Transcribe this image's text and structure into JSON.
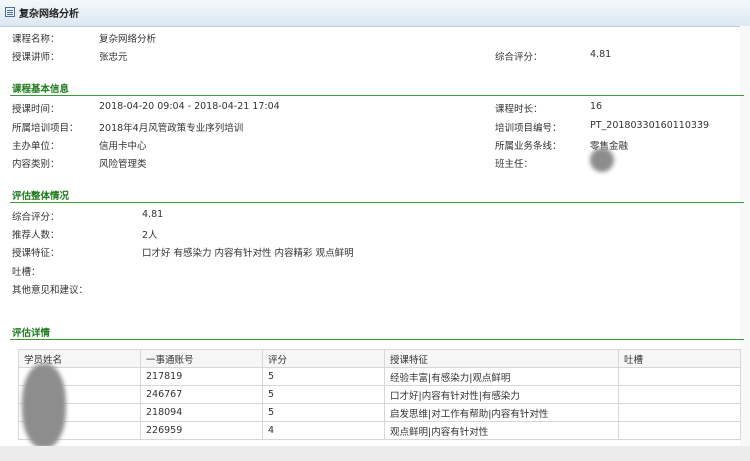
{
  "window": {
    "title": "复杂网络分析"
  },
  "header": {
    "course_name_label": "课程名称：",
    "course_name": "复杂网络分析",
    "instructor_label": "授课讲师：",
    "instructor": "张忠元",
    "score_label": "综合评分：",
    "score": "4.81"
  },
  "basic": {
    "title": "课程基本信息",
    "time_label": "授课时间：",
    "time": "2018-04-20 09:04 - 2018-04-21 17:04",
    "duration_label": "课程时长：",
    "duration": "16",
    "project_label": "所属培训项目：",
    "project": "2018年4月风管政策专业序列培训",
    "project_no_label": "培训项目编号：",
    "project_no": "PT_20180330160110339",
    "host_label": "主办单位：",
    "host": "信用卡中心",
    "line_label": "所属业务条线：",
    "line": "零售金融",
    "category_label": "内容类别：",
    "category": "风险管理类",
    "head_teacher_label": "班主任："
  },
  "eval": {
    "title": "评估整体情况",
    "score_label": "综合评分：",
    "score": "4.81",
    "recommend_label": "推荐人数：",
    "recommend": "2人",
    "features_label": "授课特征：",
    "features": "口才好 有感染力 内容有针对性 内容精彩 观点鲜明",
    "complaint_label": "吐槽：",
    "other_label": "其他意见和建议："
  },
  "details": {
    "title": "评估详情",
    "headers": [
      "学员姓名",
      "一事通账号",
      "评分",
      "授课特征",
      "吐槽"
    ],
    "rows": [
      [
        "",
        "217819",
        "5",
        "经验丰富|有感染力|观点鲜明",
        ""
      ],
      [
        "",
        "246767",
        "5",
        "口才好|内容有针对性|有感染力",
        ""
      ],
      [
        "",
        "218094",
        "5",
        "启发思维|对工作有帮助|内容有针对性",
        ""
      ],
      [
        "",
        "226959",
        "4",
        "观点鲜明|内容有针对性",
        ""
      ]
    ]
  }
}
